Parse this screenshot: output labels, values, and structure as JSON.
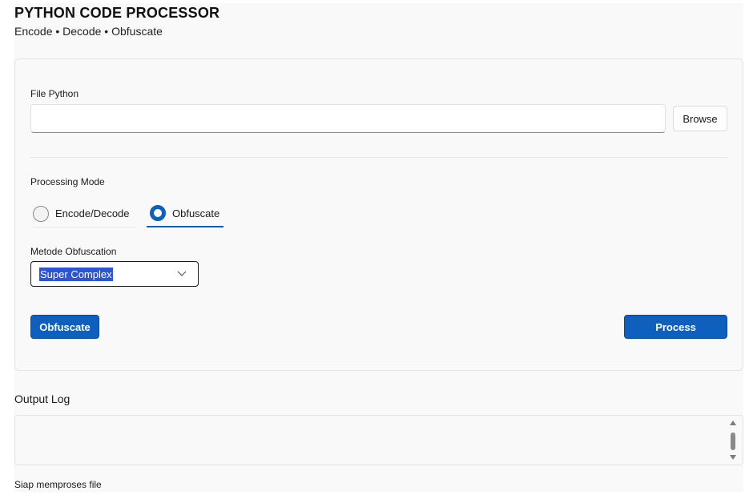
{
  "header": {
    "title": "PYTHON CODE PROCESSOR",
    "subtitle": "Encode • Decode • Obfuscate"
  },
  "file": {
    "label": "File Python",
    "value": "",
    "browse_label": "Browse"
  },
  "mode": {
    "label": "Processing Mode",
    "options": [
      {
        "label": "Encode/Decode",
        "selected": false
      },
      {
        "label": "Obfuscate",
        "selected": true
      }
    ]
  },
  "obfuscation": {
    "label": "Metode Obfuscation",
    "selected": "Super Complex"
  },
  "actions": {
    "obfuscate_label": "Obfuscate",
    "process_label": "Process"
  },
  "output": {
    "label": "Output Log",
    "content": ""
  },
  "status": {
    "text": "Siap memproses file"
  },
  "colors": {
    "accent": "#0f5fbf",
    "selection": "#2c54d4",
    "background": "#f9f9f9"
  },
  "icons": {
    "dropdown": "chevron-down-icon",
    "scroll_up": "arrow-up-icon",
    "scroll_down": "arrow-down-icon"
  }
}
